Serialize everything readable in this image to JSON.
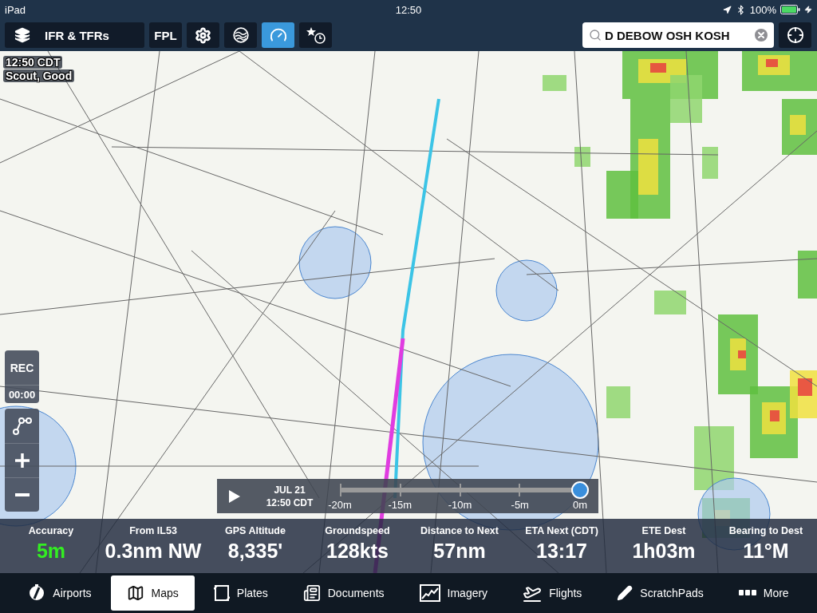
{
  "status_bar": {
    "device": "iPad",
    "time": "12:50",
    "battery": "100%"
  },
  "toolbar": {
    "layers": {
      "label": "IFR & TFRs"
    },
    "buttons": [
      {
        "kind": "text",
        "label": "FPL",
        "selected": false
      },
      {
        "kind": "settings",
        "selected": false
      },
      {
        "kind": "radar",
        "selected": false
      },
      {
        "kind": "gauge",
        "selected": true
      },
      {
        "kind": "recents",
        "selected": false
      }
    ],
    "search": {
      "value": "D DEBOW OSH KOSH"
    }
  },
  "map": {
    "clock": "12:50 CDT",
    "gps": "Scout, Good",
    "recorder": {
      "label": "REC",
      "elapsed": "00:00"
    },
    "timeline": {
      "date": "JUL 21",
      "time": "12:50 CDT",
      "ticks": [
        "-20m",
        "-15m",
        "-10m",
        "-5m",
        "0m"
      ],
      "level": 1
    }
  },
  "instruments": [
    {
      "label": "Accuracy",
      "value": "5m",
      "color": "#33ee22"
    },
    {
      "label": "From IL53",
      "value": "0.3nm NW",
      "color": "#ffffff"
    },
    {
      "label": "GPS Altitude",
      "value": "8,335'",
      "color": "#ffffff"
    },
    {
      "label": "Groundspeed",
      "value": "128kts",
      "color": "#ffffff"
    },
    {
      "label": "Distance to Next",
      "value": "57nm",
      "color": "#ffffff"
    },
    {
      "label": "ETA Next (CDT)",
      "value": "13:17",
      "color": "#ffffff"
    },
    {
      "label": "ETE Dest",
      "value": "1h03m",
      "color": "#ffffff"
    },
    {
      "label": "Bearing to Dest",
      "value": "11°M",
      "color": "#ffffff"
    }
  ],
  "tabs": [
    {
      "label": "Airports",
      "selected": false
    },
    {
      "label": "Maps",
      "selected": true
    },
    {
      "label": "Plates",
      "selected": false
    },
    {
      "label": "Documents",
      "selected": false
    },
    {
      "label": "Imagery",
      "selected": false
    },
    {
      "label": "Flights",
      "selected": false
    },
    {
      "label": "ScratchPads",
      "selected": false
    },
    {
      "label": "More",
      "selected": false
    }
  ]
}
